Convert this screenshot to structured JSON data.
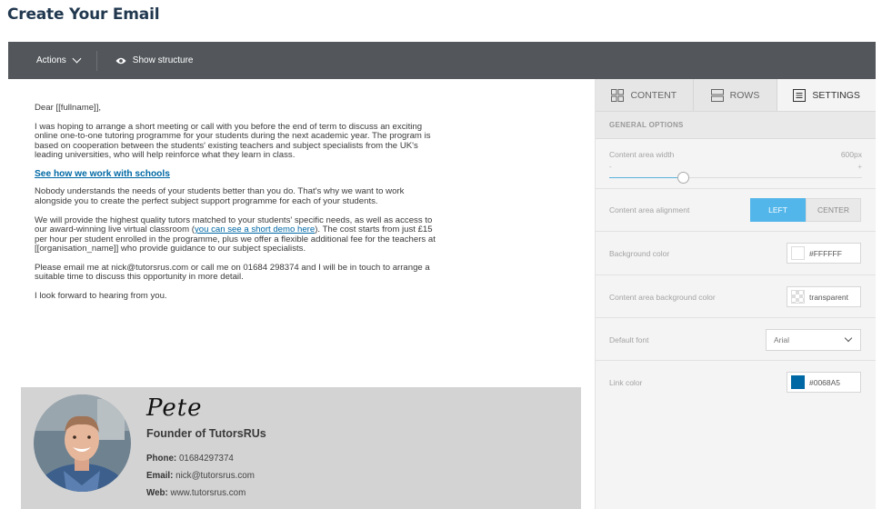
{
  "page": {
    "title": "Create Your Email"
  },
  "toolbar": {
    "actions_label": "Actions",
    "show_structure_label": "Show structure"
  },
  "email": {
    "greeting": "Dear [[fullname]],",
    "para1": "I was hoping to arrange a short meeting or call with you before the end of term to discuss an exciting online one-to-one tutoring programme for your students during the next academic year. The program is based on cooperation between the students' existing teachers and subject specialists from the UK's leading universities, who will help reinforce what they learn in class.",
    "cta_link": "See how we work with schools",
    "para2": "Nobody understands the needs of your students better than you do. That's why we want to work alongside you to create the perfect subject support programme for each of your students.",
    "para3_before": "We will provide the highest quality tutors matched to your students' specific needs, as well as access to our award-winning live virtual classroom (",
    "para3_link": "you can see a short demo here",
    "para3_after": "). The cost starts from just £15 per hour per student enrolled in the programme, plus we offer a flexible additional fee for the teachers at [[organisation_name]] who provide guidance to our subject specialists.",
    "para4": "Please email me at nick@tutorsrus.com or call me on 01684 298374 and I will be in touch to arrange a suitable time to discuss this opportunity in more detail.",
    "para5": "I look forward to hearing from you."
  },
  "signature": {
    "name": "Pete",
    "role": "Founder of TutorsRUs",
    "phone_label": "Phone:",
    "phone": "01684297374",
    "email_label": "Email:",
    "email": "nick@tutorsrus.com",
    "web_label": "Web:",
    "web": "www.tutorsrus.com"
  },
  "panel": {
    "tabs": [
      {
        "label": "CONTENT",
        "icon": "grid-icon"
      },
      {
        "label": "ROWS",
        "icon": "rows-icon"
      },
      {
        "label": "SETTINGS",
        "icon": "settings-doc-icon"
      }
    ],
    "active_tab": "SETTINGS",
    "section_title": "GENERAL OPTIONS",
    "content_width": {
      "label": "Content area width",
      "value": "600px",
      "min_symbol": "-",
      "max_symbol": "+",
      "level": 0.29
    },
    "alignment": {
      "label": "Content area alignment",
      "left": "LEFT",
      "center": "CENTER",
      "selected": "LEFT"
    },
    "background": {
      "label": "Background color",
      "value": "#FFFFFF"
    },
    "content_bg": {
      "label": "Content area background color",
      "value": "transparent"
    },
    "font": {
      "label": "Default font",
      "value": "Arial"
    },
    "link_color": {
      "label": "Link color",
      "value": "#0068A5"
    }
  },
  "colors": {
    "toolbar_bg": "#53575b",
    "accent": "#52b6ea",
    "link": "#0068A5",
    "signature_bg": "#d3d3d3"
  }
}
